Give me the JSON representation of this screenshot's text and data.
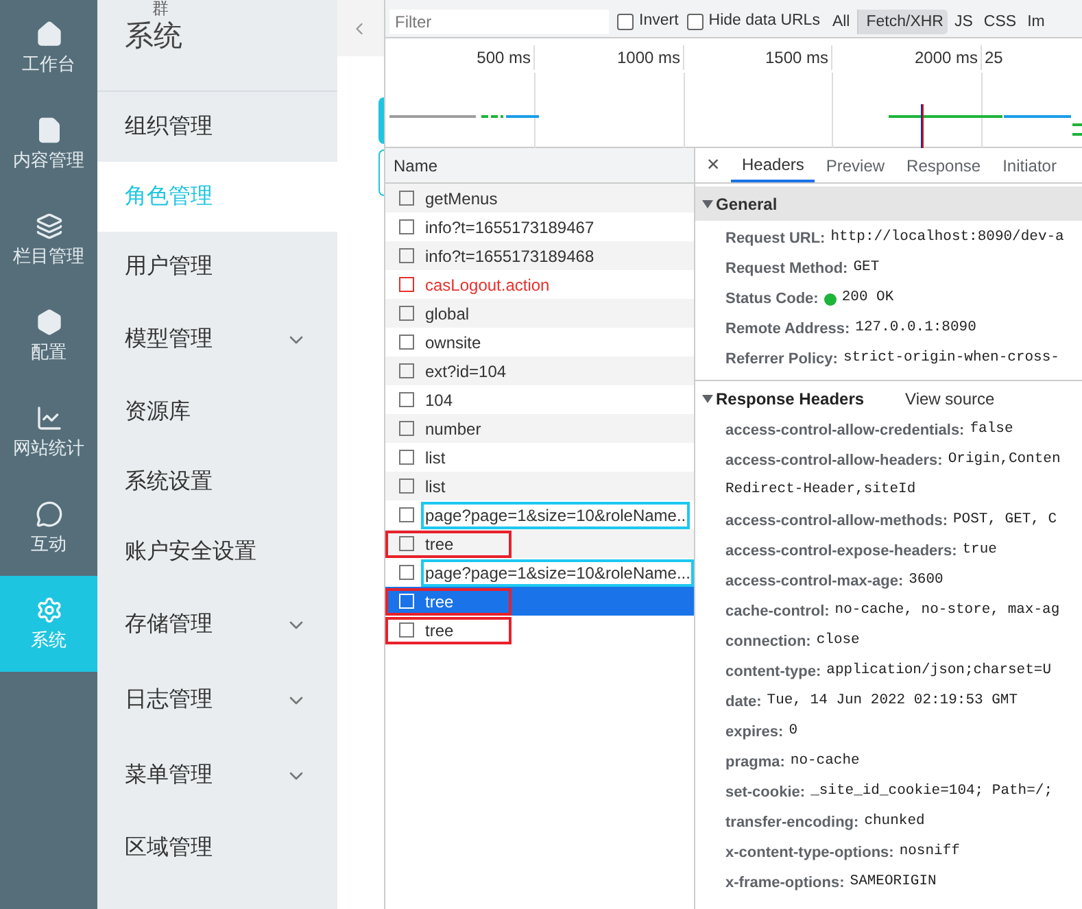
{
  "rail": [
    {
      "label": "工作台",
      "selected": false
    },
    {
      "label": "内容管理",
      "selected": false
    },
    {
      "label": "栏目管理",
      "selected": false
    },
    {
      "label": "配置",
      "selected": false
    },
    {
      "label": "网站统计",
      "selected": false
    },
    {
      "label": "互动",
      "selected": false
    },
    {
      "label": "系统",
      "selected": true
    }
  ],
  "menu": {
    "top_fragment": "群",
    "title": "系统",
    "items": [
      {
        "label": "组织管理",
        "selected": false,
        "expandable": false
      },
      {
        "label": "角色管理",
        "selected": true,
        "expandable": false
      },
      {
        "label": "用户管理",
        "selected": false,
        "expandable": false
      },
      {
        "label": "模型管理",
        "selected": false,
        "expandable": true
      },
      {
        "label": "资源库",
        "selected": false,
        "expandable": false
      },
      {
        "label": "系统设置",
        "selected": false,
        "expandable": false
      },
      {
        "label": "账户安全设置",
        "selected": false,
        "expandable": false
      },
      {
        "label": "存储管理",
        "selected": false,
        "expandable": true
      },
      {
        "label": "日志管理",
        "selected": false,
        "expandable": true
      },
      {
        "label": "菜单管理",
        "selected": false,
        "expandable": true
      },
      {
        "label": "区域管理",
        "selected": false,
        "expandable": false
      }
    ]
  },
  "devtools": {
    "filter": {
      "placeholder": "Filter"
    },
    "checkboxes": [
      {
        "label": "Invert",
        "checked": false
      },
      {
        "label": "Hide data URLs",
        "checked": false
      }
    ],
    "type_filters": [
      {
        "label": "All",
        "selected": false
      },
      {
        "label": "Fetch/XHR",
        "selected": true
      },
      {
        "label": "JS",
        "selected": false
      },
      {
        "label": "CSS",
        "selected": false
      },
      {
        "label": "Im",
        "selected": false
      }
    ],
    "timeline_ticks": [
      "500 ms",
      "1000 ms",
      "1500 ms",
      "2000 ms",
      "25"
    ],
    "name_header": "Name",
    "requests": [
      {
        "name": "getMenus",
        "selected": false,
        "failed": false
      },
      {
        "name": "info?t=1655173189467",
        "selected": false,
        "failed": false
      },
      {
        "name": "info?t=1655173189468",
        "selected": false,
        "failed": false
      },
      {
        "name": "casLogout.action",
        "selected": false,
        "failed": true
      },
      {
        "name": "global",
        "selected": false,
        "failed": false
      },
      {
        "name": "ownsite",
        "selected": false,
        "failed": false
      },
      {
        "name": "ext?id=104",
        "selected": false,
        "failed": false
      },
      {
        "name": "104",
        "selected": false,
        "failed": false
      },
      {
        "name": "number",
        "selected": false,
        "failed": false
      },
      {
        "name": "list",
        "selected": false,
        "failed": false
      },
      {
        "name": "list",
        "selected": false,
        "failed": false
      },
      {
        "name": "page?page=1&size=10&roleName..",
        "selected": false,
        "failed": false,
        "annotation": {
          "color": "#1ec8f0",
          "kind": "text"
        }
      },
      {
        "name": "tree",
        "selected": false,
        "failed": false,
        "annotation": {
          "color": "#e8212b",
          "kind": "row"
        }
      },
      {
        "name": "page?page=1&size=10&roleName...",
        "selected": false,
        "failed": false,
        "annotation": {
          "color": "#1ec8f0",
          "kind": "text"
        }
      },
      {
        "name": "tree",
        "selected": true,
        "failed": false,
        "annotation": {
          "color": "#e8212b",
          "kind": "row"
        }
      },
      {
        "name": "tree",
        "selected": false,
        "failed": false,
        "annotation": {
          "color": "#e8212b",
          "kind": "row"
        }
      }
    ],
    "detail_tabs": [
      {
        "label": "Headers",
        "selected": true
      },
      {
        "label": "Preview",
        "selected": false
      },
      {
        "label": "Response",
        "selected": false
      },
      {
        "label": "Initiator",
        "selected": false
      }
    ],
    "close_glyph": "×",
    "general": {
      "title": "General",
      "expanded": true,
      "fields": [
        {
          "name": "Request URL:",
          "value": "http://localhost:8090/dev-a",
          "status_dot": false
        },
        {
          "name": "Request Method:",
          "value": "GET",
          "status_dot": false
        },
        {
          "name": "Status Code:",
          "value": "200 OK",
          "status_dot": true
        },
        {
          "name": "Remote Address:",
          "value": "127.0.0.1:8090",
          "status_dot": false
        },
        {
          "name": "Referrer Policy:",
          "value": "strict-origin-when-cross-",
          "status_dot": false
        }
      ]
    },
    "response_headers": {
      "title": "Response Headers",
      "expanded": true,
      "view_source": "View source",
      "headers": [
        {
          "kind": "header",
          "name": "access-control-allow-credentials:",
          "value": "false"
        },
        {
          "kind": "header",
          "name": "access-control-allow-headers:",
          "value": "Origin,Conten"
        },
        {
          "kind": "continuation",
          "value": "Redirect-Header,siteId"
        },
        {
          "kind": "header",
          "name": "access-control-allow-methods:",
          "value": "POST, GET, C"
        },
        {
          "kind": "header",
          "name": "access-control-expose-headers:",
          "value": "true"
        },
        {
          "kind": "header",
          "name": "access-control-max-age:",
          "value": "3600"
        },
        {
          "kind": "header",
          "name": "cache-control:",
          "value": "no-cache, no-store, max-ag"
        },
        {
          "kind": "header",
          "name": "connection:",
          "value": "close"
        },
        {
          "kind": "header",
          "name": "content-type:",
          "value": "application/json;charset=U"
        },
        {
          "kind": "header",
          "name": "date:",
          "value": "Tue, 14 Jun 2022 02:19:53 GMT"
        },
        {
          "kind": "header",
          "name": "expires:",
          "value": "0"
        },
        {
          "kind": "header",
          "name": "pragma:",
          "value": "no-cache"
        },
        {
          "kind": "header",
          "name": "set-cookie:",
          "value": "_site_id_cookie=104; Path=/;"
        },
        {
          "kind": "header",
          "name": "transfer-encoding:",
          "value": "chunked"
        },
        {
          "kind": "header",
          "name": "x-content-type-options:",
          "value": "nosniff"
        },
        {
          "kind": "header",
          "name": "x-frame-options:",
          "value": "SAMEORIGIN"
        }
      ]
    }
  }
}
